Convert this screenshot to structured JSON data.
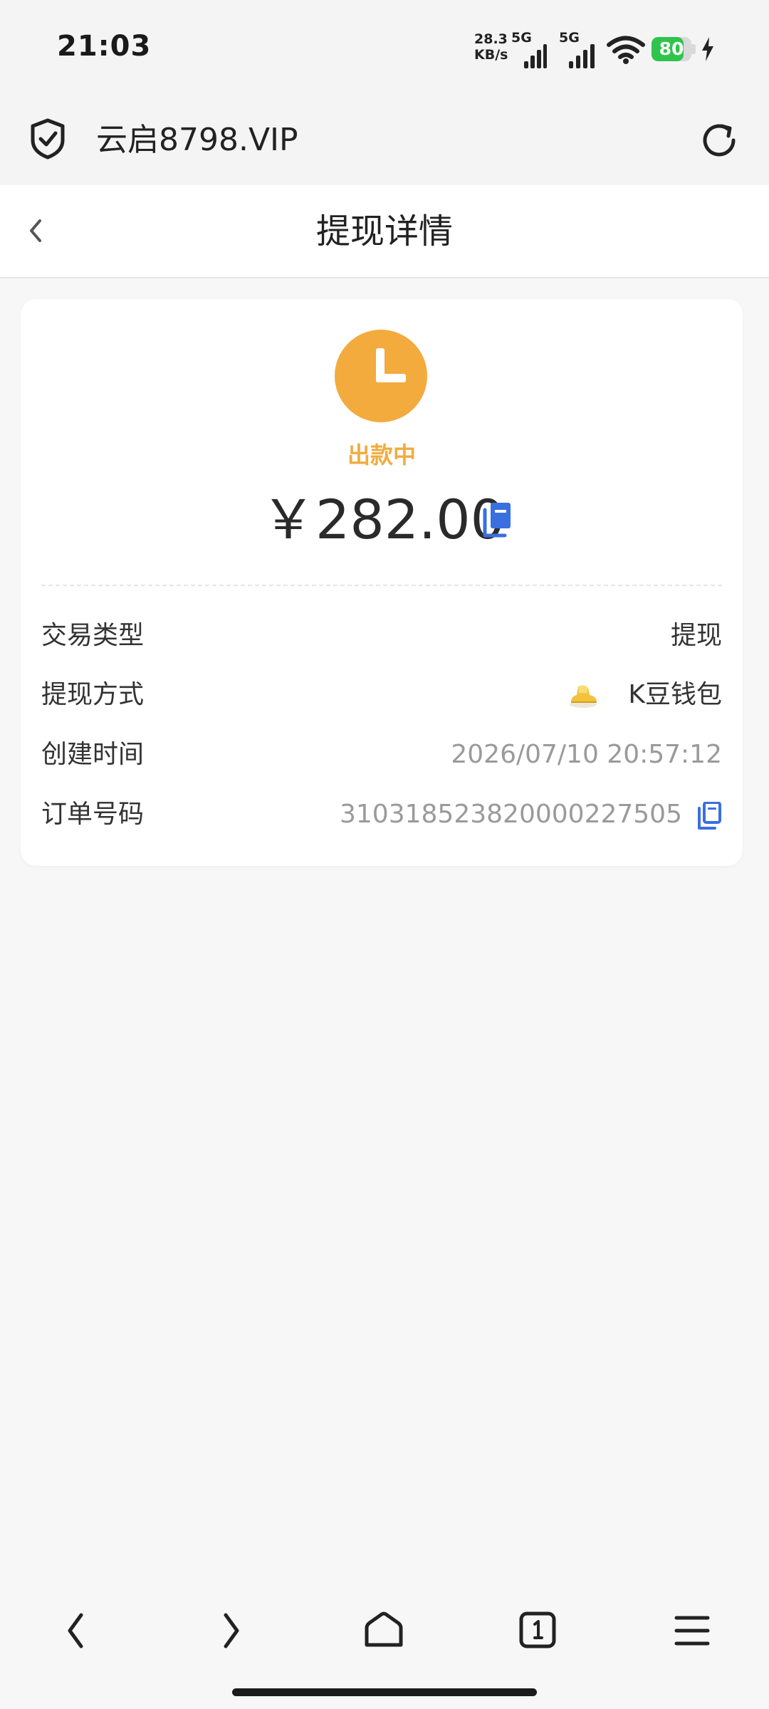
{
  "status_bar": {
    "time": "21:03",
    "net_speed_value": "28.3",
    "net_speed_unit": "KB/s",
    "signal_1_label": "5G",
    "signal_2_label": "5G",
    "battery_level": 80,
    "battery_label": "80",
    "battery_color": "#2fc44b"
  },
  "browser": {
    "url": "云启8798.VIP"
  },
  "header": {
    "title": "提现详情"
  },
  "card": {
    "status_text": "出款中",
    "status_color": "#f3ab3e",
    "amount": "￥282.00",
    "rows": [
      {
        "label": "交易类型",
        "value": "提现"
      },
      {
        "label": "提现方式",
        "value": "K豆钱包"
      },
      {
        "label": "创建时间",
        "value": "2026/07/10 20:57:12"
      },
      {
        "label": "订单号码",
        "value": "3103185238200002275 05"
      }
    ],
    "order_number": "310318523820000227505",
    "accent_color": "#3a6fe0"
  },
  "icons": {
    "back": "chevron-left-icon",
    "reload": "reload-icon",
    "shield": "shield-check-icon",
    "copy": "copy-icon",
    "status": "clock-icon",
    "wallet": "gold-shoe-icon"
  }
}
